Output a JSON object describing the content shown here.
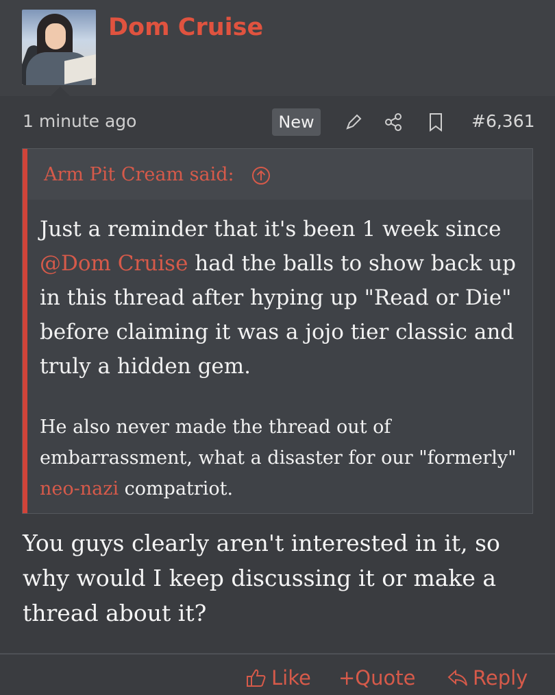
{
  "post": {
    "username": "Dom Cruise",
    "time": "1 minute ago",
    "new_badge": "New",
    "post_number": "#6,361",
    "quote": {
      "author": "Arm Pit Cream said:",
      "p1_before": "Just a reminder that it's been 1 week since ",
      "p1_mention": "@Dom Cruise",
      "p1_after": " had the balls to show back up in this thread after hyping up \"Read or Die\" before claiming it was a jojo tier classic and truly a hidden gem.",
      "p2_before": "He also never made the thread out of embarrassment, what a disaster for our \"formerly\" ",
      "p2_link": "neo-nazi",
      "p2_after": " compatriot."
    },
    "reply": "You guys clearly aren't interested in it, so why would I keep discussing it or make a thread about it?"
  },
  "actions": {
    "like": "Like",
    "quote": "+Quote",
    "reply": "Reply"
  },
  "icons": {
    "edit": "pen-icon",
    "share": "share-icon",
    "bookmark": "bookmark-icon",
    "up": "arrow-up-circle-icon",
    "like": "thumbs-up-icon",
    "reply": "reply-arrow-icon"
  },
  "colors": {
    "accent": "#e0533f",
    "background": "#3a3c40"
  }
}
